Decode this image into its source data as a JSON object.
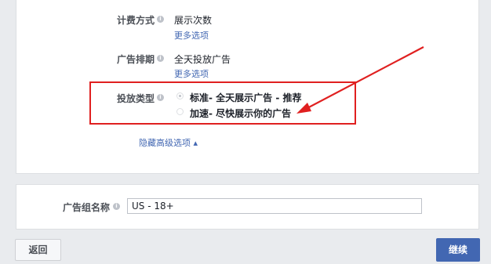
{
  "billing": {
    "label": "计费方式",
    "value": "展示次数",
    "more_link": "更多选项"
  },
  "schedule": {
    "label": "广告排期",
    "value": "全天投放广告",
    "more_link": "更多选项"
  },
  "delivery_type": {
    "label": "投放类型",
    "options": [
      {
        "label": "标准- 全天展示广告 - 推荐",
        "selected": true
      },
      {
        "label": "加速- 尽快展示你的广告",
        "selected": false
      }
    ]
  },
  "hide_advanced_link": "隐藏高级选项 ▴",
  "ad_set_name": {
    "label": "广告组名称",
    "value": "US - 18+"
  },
  "footer": {
    "back_label": "返回",
    "continue_label": "继续"
  },
  "colors": {
    "accent": "#4267b2",
    "annotation": "#e02020"
  },
  "icons": {
    "info": "info-icon"
  }
}
